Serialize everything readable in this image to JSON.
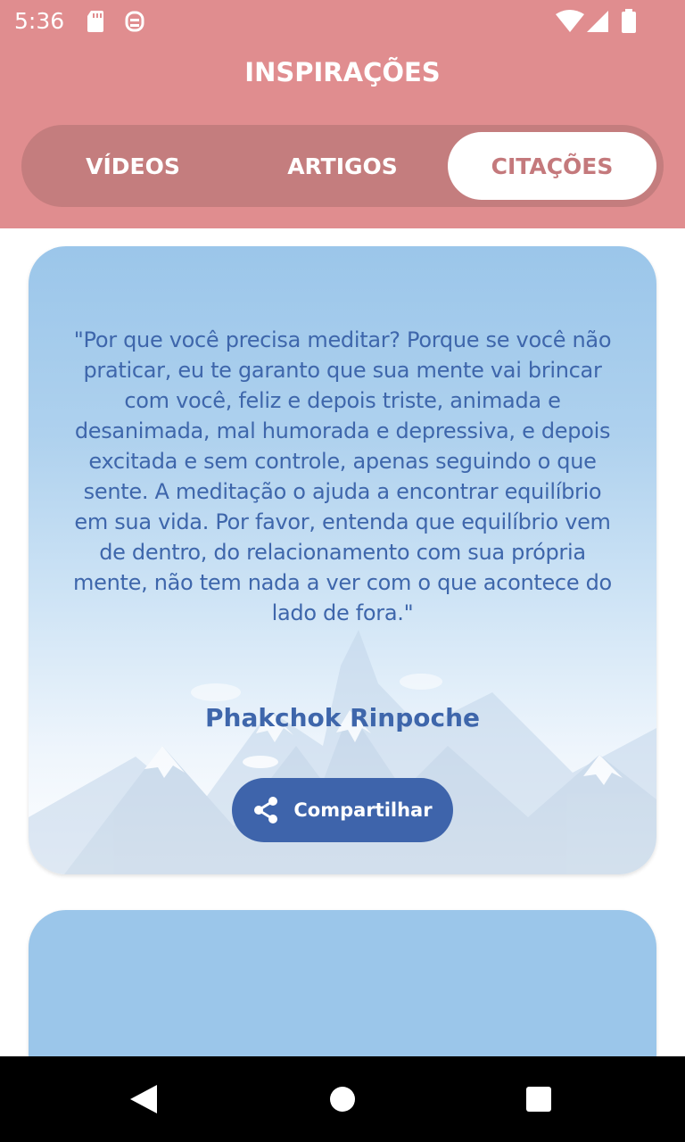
{
  "status_bar": {
    "time": "5:36",
    "icons": [
      "sd-card-icon",
      "debug-icon",
      "wifi-icon",
      "signal-icon",
      "battery-icon"
    ]
  },
  "header": {
    "title": "INSPIRAÇÕES",
    "tabs": [
      {
        "label": "VÍDEOS",
        "selected": false
      },
      {
        "label": "ARTIGOS",
        "selected": false
      },
      {
        "label": "CITAÇÕES",
        "selected": true
      }
    ]
  },
  "quotes": [
    {
      "text": "\"Por que você precisa meditar? Porque se você não praticar, eu te garanto que sua mente vai brincar com você, feliz e depois triste, animada e desanimada, mal humorada e depressiva, e depois excitada e sem controle, apenas seguindo o que sente. A meditação o ajuda a encontrar equilíbrio em sua vida. Por favor, entenda que equilíbrio vem de dentro, do relacionamento com sua própria mente, não tem nada a ver com o que acontece do lado de fora.\"",
      "author": "Phakchok Rinpoche",
      "share_label": "Compartilhar"
    }
  ],
  "colors": {
    "header_bg": "#e08d8f",
    "tab_track": "#c47d7e",
    "selected_tab_text": "#c4797c",
    "quote_text": "#3e66ab",
    "share_button": "#3e64ab",
    "card_top": "#9bc6ea"
  },
  "nav_bar": {
    "icons": [
      "back-icon",
      "home-icon",
      "recents-icon"
    ]
  }
}
